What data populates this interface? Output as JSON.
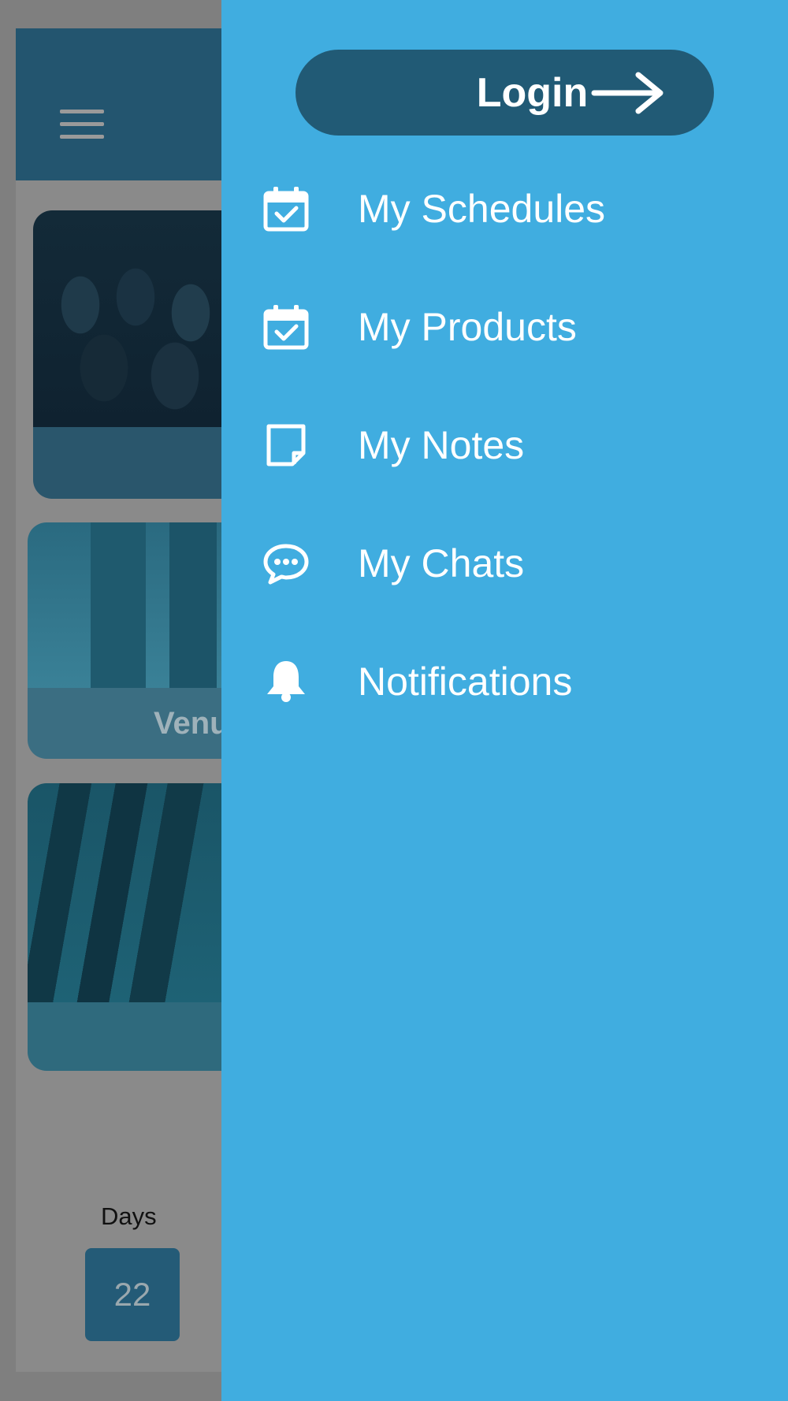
{
  "background": {
    "card2_caption": "Venu",
    "countdown": {
      "days_label": "Days",
      "days_value": "22"
    }
  },
  "drawer": {
    "login_label": "Login",
    "menu": [
      {
        "label": "My Schedules",
        "icon": "calendar-check-icon"
      },
      {
        "label": "My Products",
        "icon": "calendar-check-icon"
      },
      {
        "label": "My Notes",
        "icon": "note-icon"
      },
      {
        "label": "My Chats",
        "icon": "chat-bubble-icon"
      },
      {
        "label": "Notifications",
        "icon": "bell-icon"
      }
    ]
  },
  "colors": {
    "drawer_bg": "#40ade0",
    "login_bg": "#215a75",
    "header_bg": "#23556f"
  }
}
